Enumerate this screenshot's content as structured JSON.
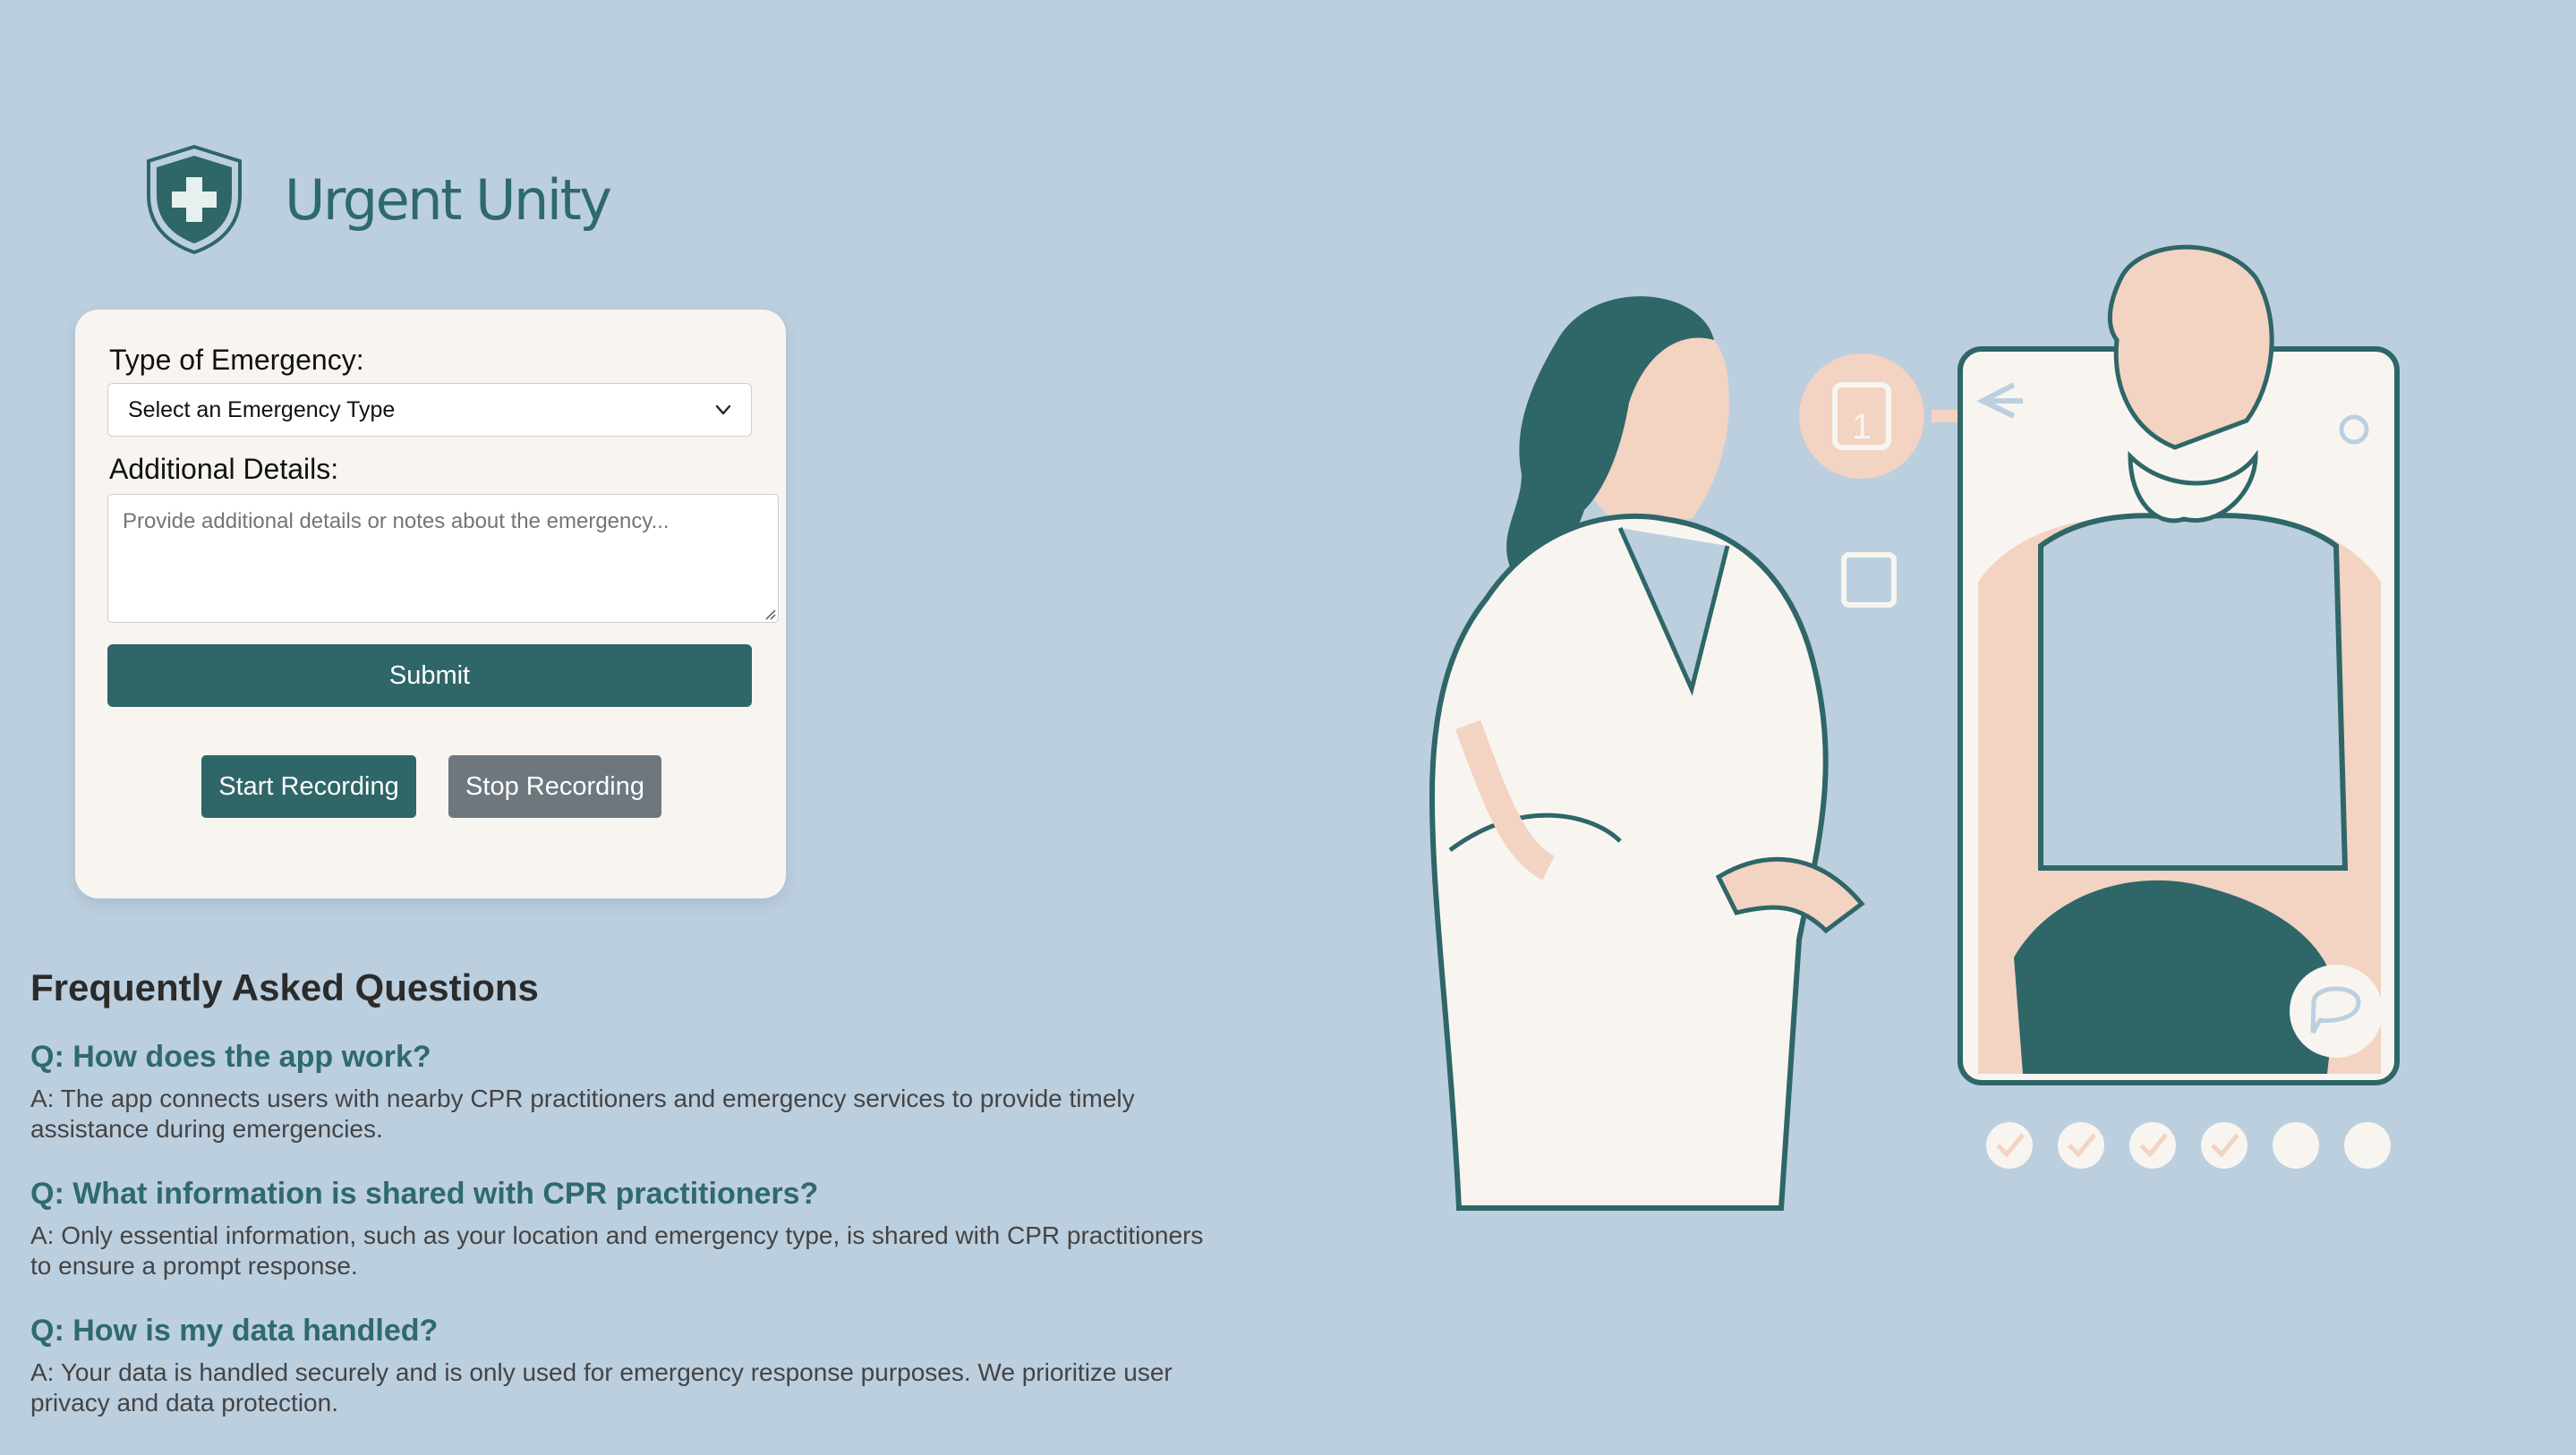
{
  "brand": {
    "name": "Urgent Unity",
    "logo_icon": "shield-cross-icon"
  },
  "form": {
    "emergency_type_label": "Type of Emergency:",
    "emergency_type_selected": "Select an Emergency Type",
    "details_label": "Additional Details:",
    "details_placeholder": "Provide additional details or notes about the emergency...",
    "details_value": "",
    "submit_label": "Submit",
    "start_recording_label": "Start Recording",
    "stop_recording_label": "Stop Recording"
  },
  "faq": {
    "title": "Frequently Asked Questions",
    "items": [
      {
        "q": "Q: How does the app work?",
        "a": "A: The app connects users with nearby CPR practitioners and emergency services to provide timely assistance during emergencies."
      },
      {
        "q": "Q: What information is shared with CPR practitioners?",
        "a": "A: Only essential information, such as your location and emergency type, is shared with CPR practitioners to ensure a prompt response."
      },
      {
        "q": "Q: How is my data handled?",
        "a": "A: Your data is handled securely and is only used for emergency response purposes. We prioritize user privacy and data protection."
      }
    ]
  },
  "colors": {
    "background": "#bccfdf",
    "brand_teal": "#2f6668",
    "card": "#f8f5f0",
    "stop_gray": "#6e777e",
    "skin_peach": "#f3d3c2"
  }
}
